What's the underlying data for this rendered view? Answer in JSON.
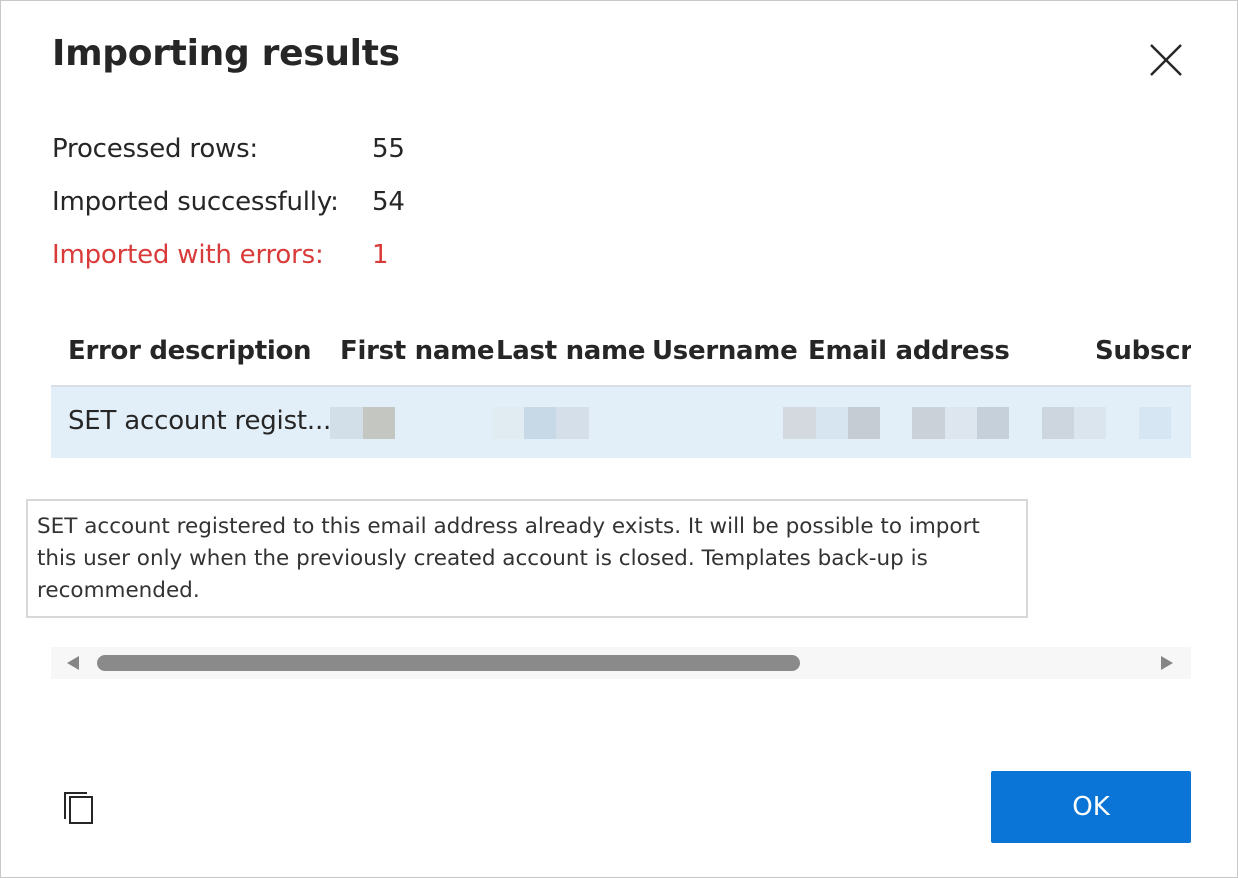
{
  "dialog": {
    "title": "Importing results",
    "close_icon": "close-icon"
  },
  "stats": [
    {
      "label": "Processed rows:",
      "value": "55"
    },
    {
      "label": "Imported successfully:",
      "value": "54"
    },
    {
      "label": "Imported with errors:",
      "value": "1"
    }
  ],
  "colors": {
    "error": "#d93b3b",
    "accent": "#0a75d6",
    "row_selected": "#e3eff8"
  },
  "table": {
    "columns": [
      "Error description",
      "First name",
      "Last name",
      "Username",
      "Email address",
      "Subscri"
    ],
    "rows": [
      {
        "error_description": "SET account regist..."
      }
    ]
  },
  "tooltip": {
    "text": "SET account registered to this email address already exists. It will be possible to import this user only when the previously created account is closed. Templates back-up is recommended."
  },
  "footer": {
    "copy_icon": "copy-icon",
    "ok_label": "OK"
  }
}
